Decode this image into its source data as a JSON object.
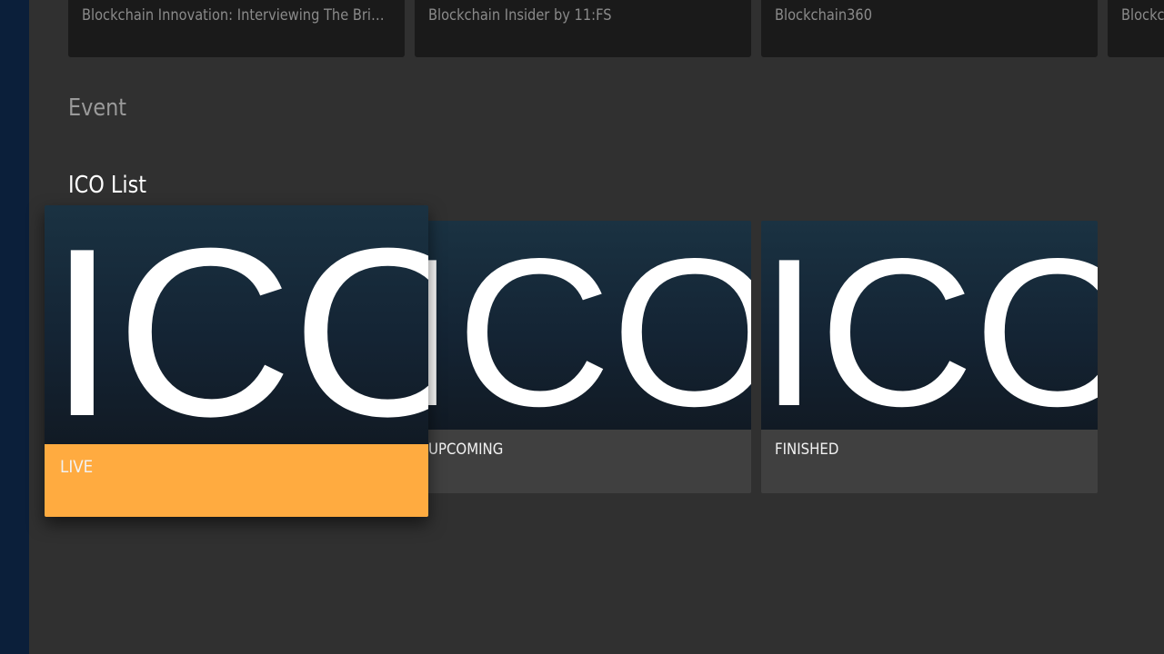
{
  "top_row": {
    "cards": [
      {
        "title": "Blockchain Innovation: Interviewing The Brig…"
      },
      {
        "title": "Blockchain Insider by 11:FS"
      },
      {
        "title": "Blockchain360"
      },
      {
        "title": "Blockc"
      }
    ]
  },
  "sections": {
    "event": {
      "title": "Event"
    },
    "ico_list": {
      "title": "ICO List",
      "cards": [
        {
          "label": "LIVE",
          "art_text": "ICO",
          "focused": true,
          "caption_color": "#ffab40"
        },
        {
          "label": "UPCOMING",
          "art_text": "ICO",
          "focused": false,
          "caption_color": "#404040"
        },
        {
          "label": "FINISHED",
          "art_text": "ICO",
          "focused": false,
          "caption_color": "#404040"
        }
      ]
    }
  },
  "colors": {
    "background": "#303030",
    "side_rail": "#0b1f3a",
    "focus_accent": "#ffab40",
    "top_card_bg": "#1a1a1a"
  }
}
